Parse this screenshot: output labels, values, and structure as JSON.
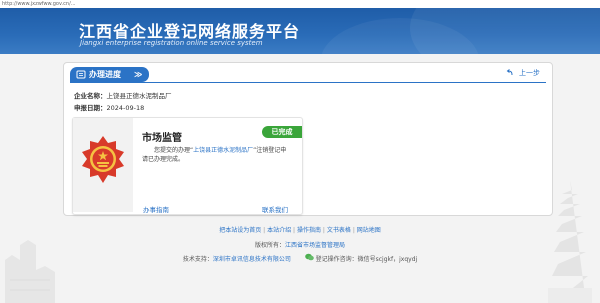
{
  "address_bar": "http://www.jxzwfww.gov.cn/...",
  "banner": {
    "title": "江西省企业登记网络服务平台",
    "subtitle": "Jiangxi enterprise registration online service system"
  },
  "panel": {
    "tab_label": "办理进度",
    "tab_arrows": "≫",
    "back_label": "上一步"
  },
  "info": {
    "company_label": "企业名称：",
    "company_name": "上饶县正德水泥制品厂",
    "date_label": "申报日期：",
    "date_value": "2024-09-18"
  },
  "card": {
    "title": "市场监管",
    "status": "已完成",
    "message_pre": "您提交的办理“",
    "message_highlight": "上饶县正德水泥制品厂",
    "message_post": "”注销登记申请已办理完成。",
    "link_guide": "办事指南",
    "link_contact": "联系我们"
  },
  "footer": {
    "links": [
      "把本站设为首页",
      "本站介绍",
      "操作指南",
      "文书表格",
      "网站地图"
    ],
    "separator": "|",
    "copyright_label": "版权所有：",
    "copyright_owner": "江西省市场监督管理局",
    "support_label": "技术支持：",
    "support_company": "深圳市卓讯信息技术有限公司",
    "consult_label": "登记操作咨询：微信号scjgkf，jxqydj"
  },
  "colors": {
    "brand_blue": "#2b73c6",
    "banner_blue": "#1f5da8",
    "status_green": "#3aa53a"
  }
}
